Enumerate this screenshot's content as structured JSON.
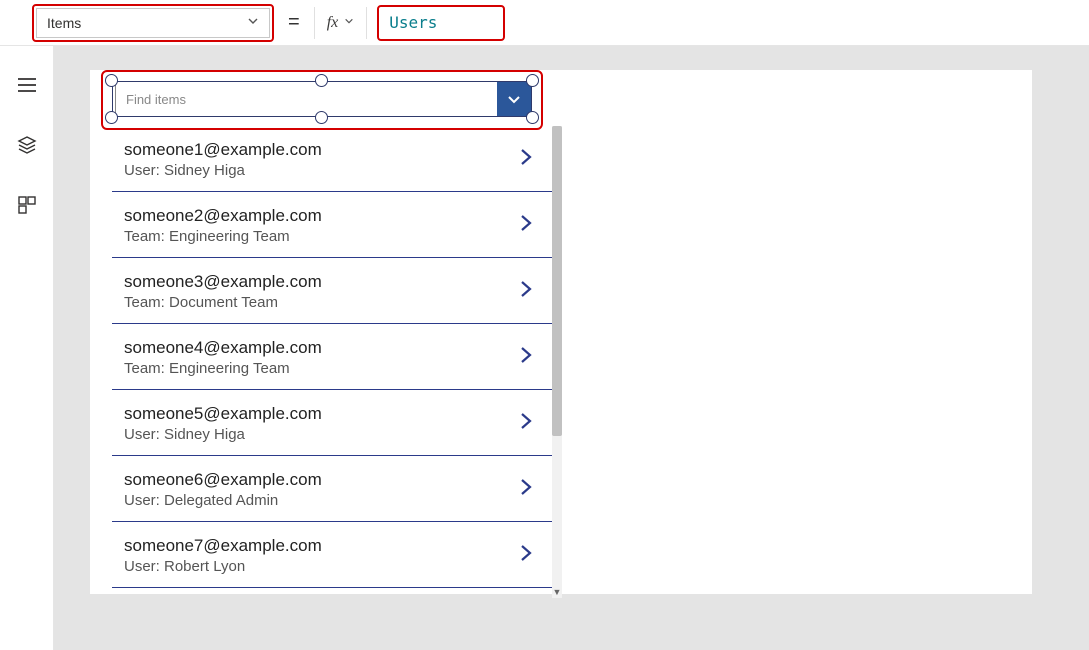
{
  "formulaBar": {
    "property": "Items",
    "equals": "=",
    "fx": "fx",
    "formula": "Users"
  },
  "combobox": {
    "placeholder": "Find items"
  },
  "gallery": [
    {
      "title": "someone1@example.com",
      "subtitle": "User: Sidney Higa"
    },
    {
      "title": "someone2@example.com",
      "subtitle": "Team: Engineering Team"
    },
    {
      "title": "someone3@example.com",
      "subtitle": "Team: Document Team"
    },
    {
      "title": "someone4@example.com",
      "subtitle": "Team: Engineering Team"
    },
    {
      "title": "someone5@example.com",
      "subtitle": "User: Sidney Higa"
    },
    {
      "title": "someone6@example.com",
      "subtitle": "User: Delegated Admin"
    },
    {
      "title": "someone7@example.com",
      "subtitle": "User: Robert Lyon"
    }
  ]
}
